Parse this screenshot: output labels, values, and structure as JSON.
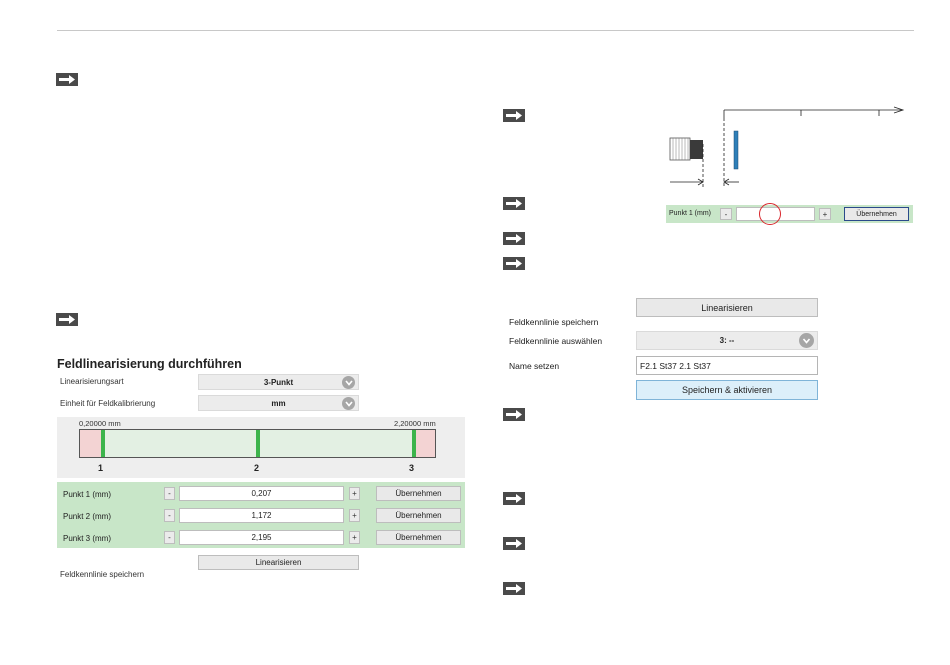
{
  "left": {
    "title": "Feldlinearisierung durchführen",
    "rows": [
      {
        "label": "Linearisierungsart",
        "value": "3-Punkt"
      },
      {
        "label": "Einheit für Feldkalibrierung",
        "value": "mm"
      }
    ],
    "scale": {
      "min_label": "0,20000 mm",
      "max_label": "2,20000 mm",
      "markers": [
        "1",
        "2",
        "3"
      ]
    },
    "points": [
      {
        "label": "Punkt 1 (mm)",
        "value": "0,207",
        "minus": "-",
        "plus": "+",
        "button": "Übernehmen"
      },
      {
        "label": "Punkt 2 (mm)",
        "value": "1,172",
        "minus": "-",
        "plus": "+",
        "button": "Übernehmen"
      },
      {
        "label": "Punkt 3 (mm)",
        "value": "2,195",
        "minus": "-",
        "plus": "+",
        "button": "Übernehmen"
      }
    ],
    "linearize_button": "Linearisieren",
    "save_label": "Feldkennlinie speichern"
  },
  "right": {
    "mini_panel": {
      "label": "Punkt 1 (mm)",
      "minus": "-",
      "plus": "+",
      "button": "Übernehmen"
    },
    "linearize_button": "Linearisieren",
    "save_label": "Feldkennlinie speichern",
    "select_label": "Feldkennlinie auswählen",
    "select_value": "3: --",
    "name_label": "Name setzen",
    "name_value": "F2.1 St37 2.1 St37",
    "save_activate_button": "Speichern & aktivieren"
  },
  "colors": {
    "panel_green": "#c8e6c8",
    "marker_green": "#3cb44b",
    "accent_blue": "#2f7fb8",
    "highlight_red": "#d9262c"
  }
}
